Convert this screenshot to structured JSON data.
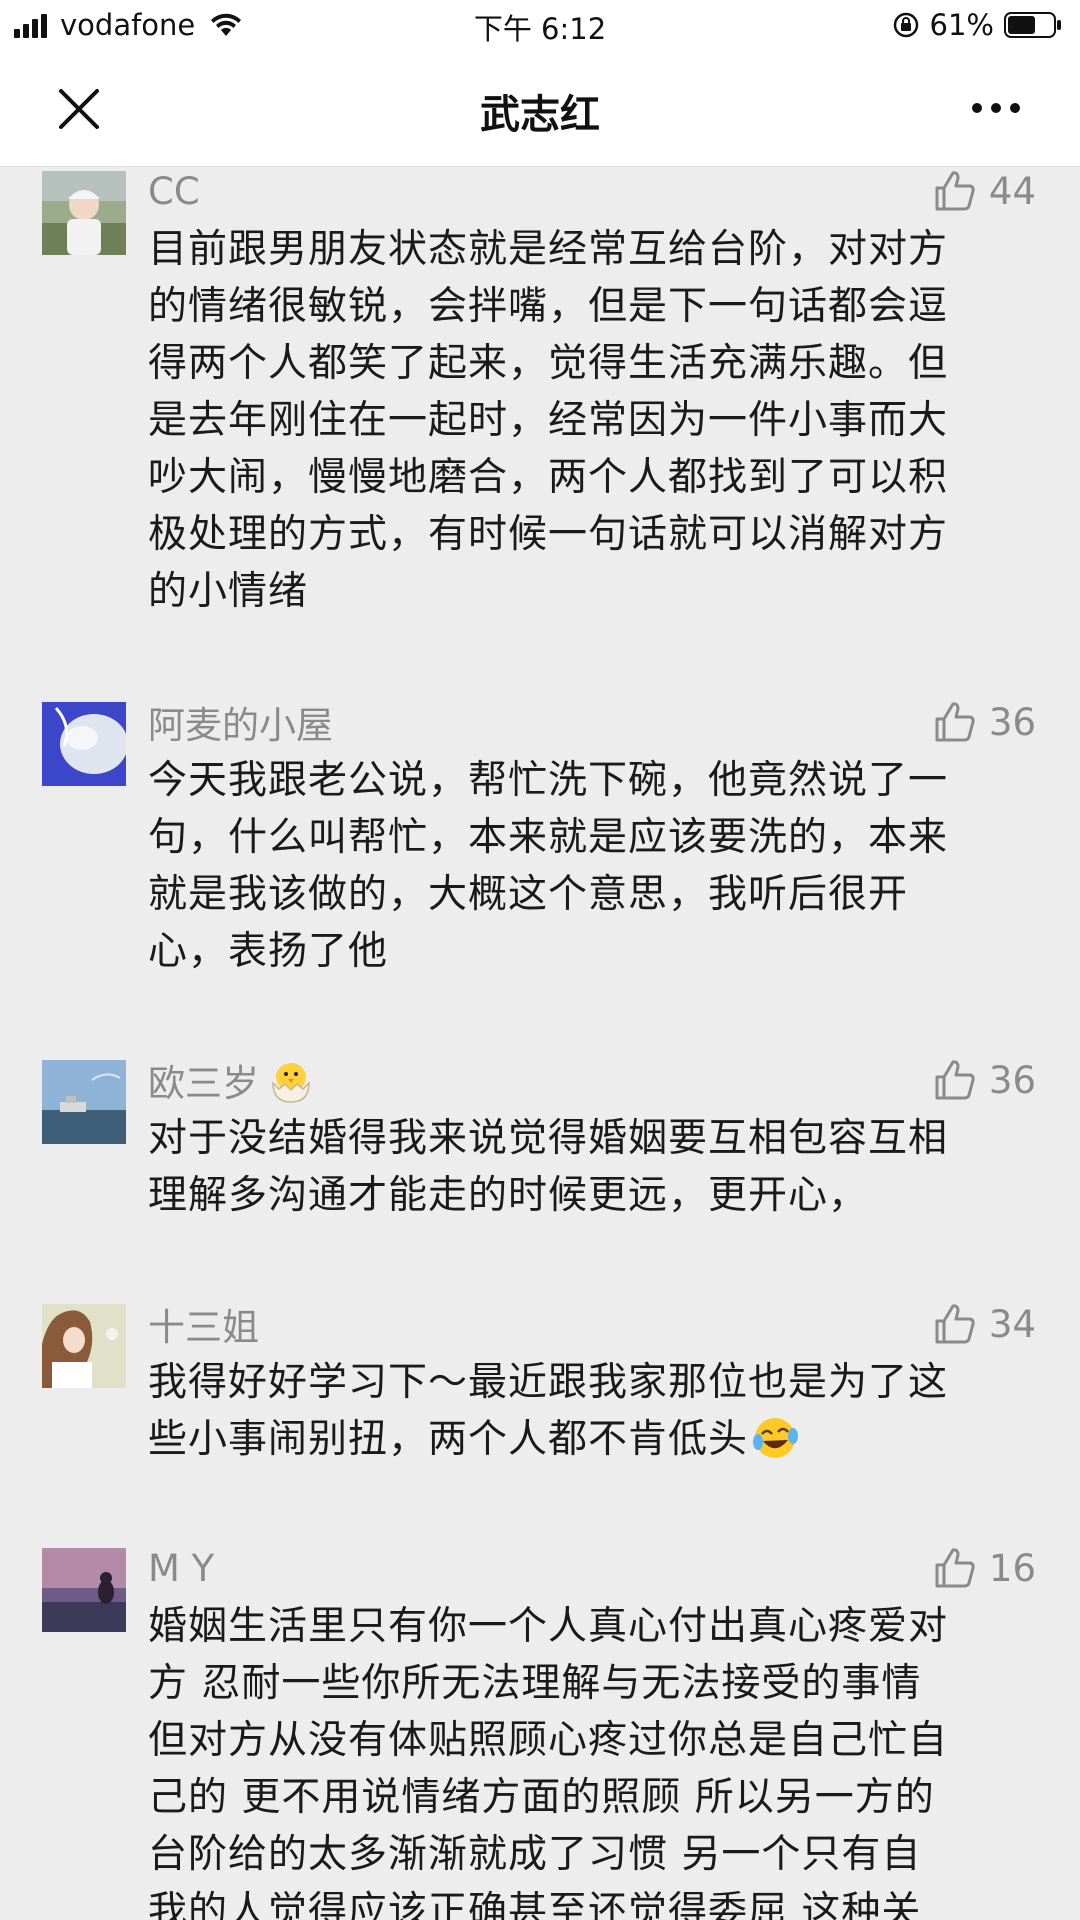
{
  "status_bar": {
    "carrier": "vodafone",
    "time": "下午 6:12",
    "battery_percent": "61%",
    "battery_level": 0.61
  },
  "nav": {
    "title": "武志红"
  },
  "comments": [
    {
      "name": "CC",
      "likes": "44",
      "text": "目前跟男朋友状态就是经常互给台阶，对对方\n的情绪很敏锐，会拌嘴，但是下一句话都会逗\n得两个人都笑了起来，觉得生活充满乐趣。但\n是去年刚住在一起时，经常因为一件小事而大\n吵大闹，慢慢地磨合，两个人都找到了可以积\n极处理的方式，有时候一句话就可以消解对方\n的小情绪"
    },
    {
      "name": "阿麦的小屋",
      "likes": "36",
      "text": "今天我跟老公说，帮忙洗下碗，他竟然说了一\n句，什么叫帮忙，本来就是应该要洗的，本来\n就是我该做的，大概这个意思，我听后很开\n心，表扬了他"
    },
    {
      "name": "欧三岁",
      "likes": "36",
      "text": "对于没结婚得我来说觉得婚姻要互相包容互相\n理解多沟通才能走的时候更远，更开心，"
    },
    {
      "name": "十三姐",
      "likes": "34",
      "text": "我得好好学习下～最近跟我家那位也是为了这\n些小事闹别扭，两个人都不肯低头"
    },
    {
      "name": "M Y",
      "likes": "16",
      "text": "婚姻生活里只有你一个人真心付出真心疼爱对\n方 忍耐一些你所无法理解与无法接受的事情\n但对方从没有体贴照顾心疼过你总是自己忙自\n己的 更不用说情绪方面的照顾  所以另一方的\n台阶给的太多渐渐就成了习惯 另一个只有自\n我的人觉得应该正确甚至还觉得委屈  这种关"
    }
  ]
}
